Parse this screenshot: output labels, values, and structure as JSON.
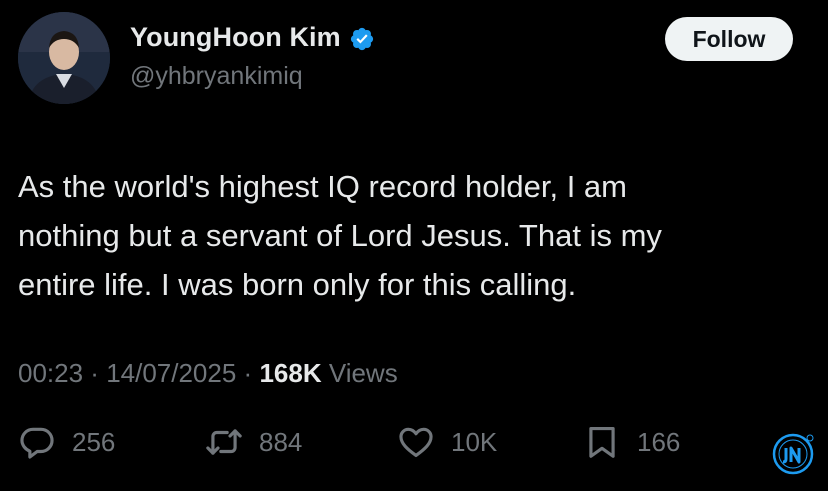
{
  "author": {
    "display_name": "YoungHoon Kim",
    "handle": "@yhbryankimiq",
    "verified": true
  },
  "follow_button": {
    "label": "Follow"
  },
  "tweet": {
    "text": "As the world's highest IQ record holder, I am\nnothing but a servant of Lord Jesus. That is my\nentire life. I was born only for this calling."
  },
  "meta": {
    "time": "00:23",
    "separator": " · ",
    "date": "14/07/2025",
    "views_count": "168K",
    "views_label": " Views"
  },
  "actions": {
    "replies": "256",
    "reposts": "884",
    "likes": "10K",
    "bookmarks": "166"
  },
  "colors": {
    "background": "#000000",
    "text": "#e7e9ea",
    "secondary": "#71767b",
    "verified": "#1d9bf0",
    "button_bg": "#eff3f4"
  }
}
